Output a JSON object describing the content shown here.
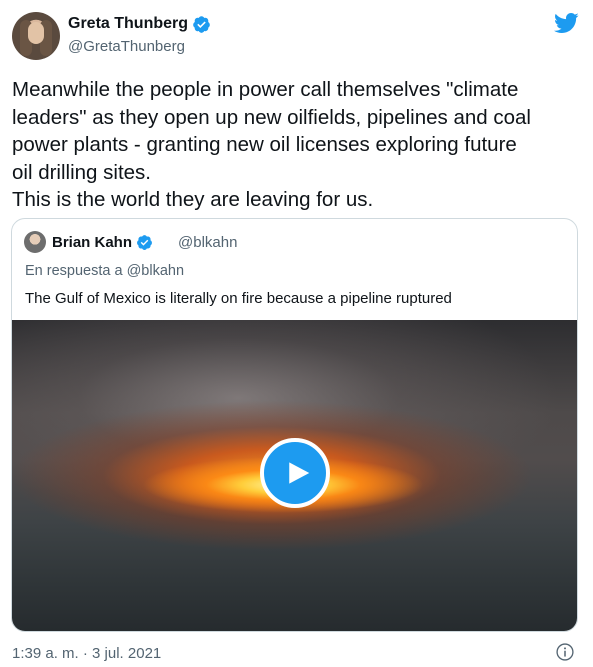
{
  "author": {
    "name": "Greta Thunberg",
    "handle": "@GretaThunberg",
    "verified": true
  },
  "tweet": {
    "text": "Meanwhile the people in power call themselves \"climate\nleaders\" as they open up new oilfields, pipelines and coal\npower plants - granting new oil licenses exploring future\noil drilling sites.\nThis is the world they are leaving for us."
  },
  "quoted_tweet": {
    "name": "Brian Kahn",
    "handle": "@blkahn",
    "verified": true,
    "reply_context": "En respuesta a @blkahn",
    "text": "The Gulf of Mexico is literally on fire because a pipeline ruptured",
    "media": {
      "type": "video",
      "play_icon": "play-icon"
    }
  },
  "footer": {
    "timestamp": "1:39 a. m. · 3 jul. 2021"
  },
  "colors": {
    "accent": "#1d9bf0",
    "text_primary": "#0f1419",
    "text_secondary": "#536471",
    "border": "#cfd9de"
  },
  "icons": {
    "brand": "twitter-bird-icon",
    "verified": "verified-badge-icon",
    "info": "info-icon"
  }
}
